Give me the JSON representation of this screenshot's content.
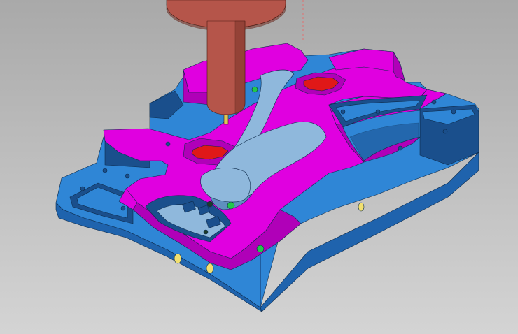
{
  "viewport": {
    "background_top": "#a9a9a9",
    "background_bottom": "#d4d4d4"
  },
  "model": {
    "colors": {
      "base_block": "#2f86d6",
      "base_block_side": "#1f63ad",
      "base_block_dark": "#1a4f8c",
      "mold_core": "#e000e0",
      "mold_core_dark": "#b000b8",
      "cavity_floor": "#e01818",
      "runner_channel": "#8fb8dc",
      "runner_channel_dark": "#5f8fbf",
      "spindle_tool": "#b5554a",
      "spindle_tool_dark": "#7a3328",
      "tool_tip": "#d8c85a",
      "bolt_holes": "#f2e070",
      "marker_green": "#21c84a",
      "marker_dark": "#1c3a2a",
      "toolpath_line": "#e07070"
    }
  }
}
